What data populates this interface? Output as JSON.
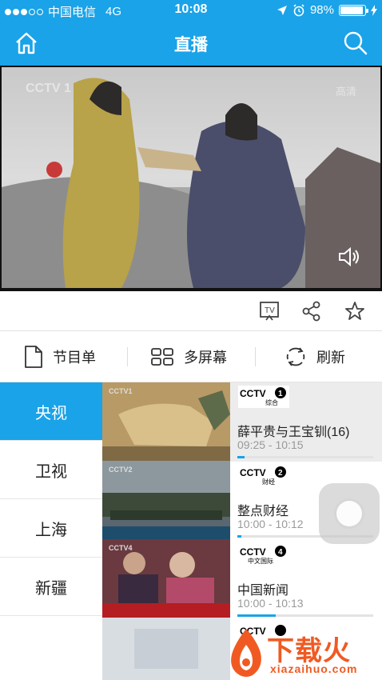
{
  "status_bar": {
    "carrier": "中国电信",
    "network": "4G",
    "time": "10:08",
    "battery": "98%",
    "battery_level": 0.98
  },
  "nav": {
    "title": "直播",
    "home_icon": "home-icon",
    "search_icon": "search-icon"
  },
  "player": {
    "channel_logo": "CCTV 1",
    "hd_badge": "高清",
    "mute_icon": "speaker-icon"
  },
  "actions": [
    {
      "icon": "tv-cast-icon"
    },
    {
      "icon": "share-icon"
    },
    {
      "icon": "star-icon"
    }
  ],
  "menu": {
    "schedule_label": "节目单",
    "multiscreen_label": "多屏幕",
    "refresh_label": "刷新"
  },
  "categories": [
    {
      "label": "央视",
      "active": true
    },
    {
      "label": "卫视",
      "active": false
    },
    {
      "label": "上海",
      "active": false
    },
    {
      "label": "新疆",
      "active": false
    }
  ],
  "programs": [
    {
      "channel": "CCTV1",
      "channel_sub": "综合",
      "title": "薛平贵与王宝钏(16)",
      "time": "09:25 - 10:15",
      "progress": 0.05
    },
    {
      "channel": "CCTV2",
      "channel_sub": "财经",
      "title": "整点财经",
      "time": "10:00 - 10:12",
      "progress": 0.03
    },
    {
      "channel": "CCTV4",
      "channel_sub": "中文国际",
      "title": "中国新闻",
      "time": "10:00 - 10:13",
      "progress": 0.28
    }
  ],
  "watermark": {
    "text": "下载火",
    "sub": "xiazaihuo.com"
  },
  "colors": {
    "accent": "#1aa3e8",
    "watermark": "#f05a22"
  }
}
